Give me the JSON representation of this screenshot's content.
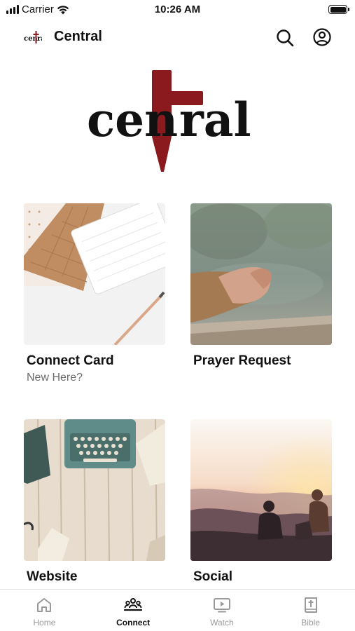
{
  "status_bar": {
    "carrier": "Carrier",
    "time": "10:26 AM"
  },
  "nav": {
    "title": "Central"
  },
  "brand": {
    "logo_text": "central",
    "cross_color": "#8b1a1f"
  },
  "cards": [
    {
      "title": "Connect Card",
      "subtitle": "New Here?",
      "image": "notebook-pencil-photo"
    },
    {
      "title": "Prayer Request",
      "subtitle": "",
      "image": "praying-hands-photo"
    },
    {
      "title": "Website",
      "subtitle": "",
      "image": "typewriter-photo"
    },
    {
      "title": "Social",
      "subtitle": "",
      "image": "sunset-friends-photo"
    }
  ],
  "tabs": [
    {
      "label": "Home",
      "icon": "home-icon",
      "active": false
    },
    {
      "label": "Connect",
      "icon": "people-icon",
      "active": true
    },
    {
      "label": "Watch",
      "icon": "play-screen-icon",
      "active": false
    },
    {
      "label": "Bible",
      "icon": "bible-icon",
      "active": false
    }
  ]
}
